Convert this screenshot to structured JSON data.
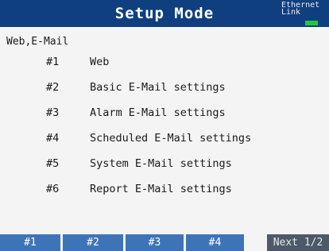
{
  "header": {
    "title": "Setup Mode",
    "ethernet_line1": "Ethernet",
    "ethernet_line2": "Link",
    "link_led_color": "#22c93a"
  },
  "section_title": "Web,E-Mail",
  "menu": [
    {
      "num": "#1",
      "label": "Web"
    },
    {
      "num": "#2",
      "label": "Basic E-Mail settings"
    },
    {
      "num": "#3",
      "label": "Alarm E-Mail settings"
    },
    {
      "num": "#4",
      "label": "Scheduled E-Mail settings"
    },
    {
      "num": "#5",
      "label": "System E-Mail settings"
    },
    {
      "num": "#6",
      "label": "Report E-Mail settings"
    }
  ],
  "softkeys": [
    "#1",
    "#2",
    "#3",
    "#4",
    "",
    "Next 1/2"
  ]
}
